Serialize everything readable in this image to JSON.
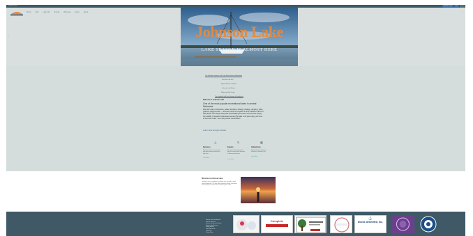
{
  "topbar": {
    "title": "Johnson Lake",
    "btn1": "Member Login",
    "btn2": "Join"
  },
  "nav": [
    "Home",
    "Visit",
    "Lake Info",
    "Events",
    "Business",
    "News",
    "About"
  ],
  "hero": {
    "title": "Johnson Lake",
    "subtitle": "LAKE SEASON IS ALMOST HERE"
  },
  "content": {
    "links": [
      "The Valentine Johnson Lake Live Event Season Information",
      "Johnson Lake Info",
      "Special Events Calendar",
      "Johnson Lake Events",
      "Watercraft Info Center",
      "The Frankfurt Hall Lake Season of Family Fun"
    ],
    "heading": "Welcome to Johnson Lake",
    "intro": "One of the most popular recreational lakes in central Nebraska.",
    "body": "With 28 miles of shoreline, water activities, fishing, boating, camping, trails, golf and playgrounds — Johnson Lake is the place to find a different kind of Nebraska. Get swept away with breathtaking sunrises and sunsets. Enjoy the wildlife. Frequent businesses around the lake. And just enjoy your time at Johnson Lake. Your stay will be memorable!",
    "cta": "Learn more and get involved"
  },
  "features": [
    {
      "icon": "anchor-icon",
      "title": "Services",
      "text": "Find boat rentals, marinas, fuel and repair services around the lake area.",
      "link": "Learn More"
    },
    {
      "icon": "pin-icon",
      "title": "Events",
      "text": "See what's happening at the lake this season, from fireworks to fishing tournaments.",
      "link": "Learn More"
    },
    {
      "icon": "calendar-icon",
      "title": "Attractions",
      "text": "Explore the best sights and activities at Johnson Lake.",
      "link": "Learn More"
    }
  ],
  "welcome": {
    "heading": "Welcome to Johnson Lake",
    "text": "Johnson Lake is a popular recreation area located in south central Nebraska. The lake offers boating, fishing, swimming and camping for visitors and residents year round."
  },
  "footer": {
    "links": [
      "Johnson Lake Development",
      "Johnson Lake Info",
      "Johnson Lake Event Calendar",
      "Johnson Lake Business",
      "Fishing Reports",
      "Lake Rules & Info",
      "Contact Us",
      "Privacy Policy"
    ],
    "sponsors": [
      "Complete",
      "Docks Unlimited, Inc."
    ]
  },
  "colors": {
    "dark": "#3f5966",
    "accent": "#e98a3c",
    "panel": "#d4dcdc",
    "blue": "#2e6ea5"
  }
}
